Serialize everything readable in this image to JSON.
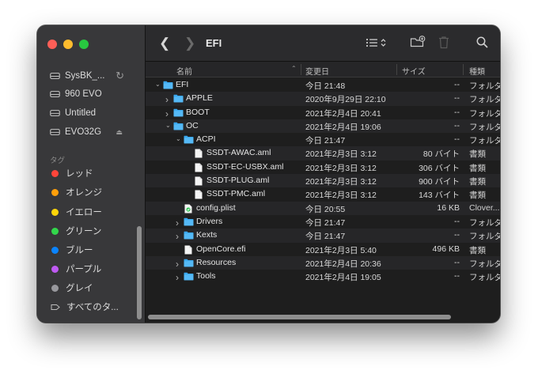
{
  "window": {
    "title": "EFI"
  },
  "sidebar": {
    "devices": [
      {
        "label": "SysBK_...",
        "icon": "disk-icon",
        "badge": "refresh"
      },
      {
        "label": "960 EVO",
        "icon": "disk-icon"
      },
      {
        "label": "Untitled",
        "icon": "disk-icon"
      },
      {
        "label": "EVO32G",
        "icon": "disk-icon",
        "badge": "eject"
      }
    ],
    "tags_heading": "タグ",
    "tags": [
      {
        "label": "レッド",
        "color": "#ff453a"
      },
      {
        "label": "オレンジ",
        "color": "#ff9f0a"
      },
      {
        "label": "イエロー",
        "color": "#ffd60a"
      },
      {
        "label": "グリーン",
        "color": "#32d74b"
      },
      {
        "label": "ブルー",
        "color": "#0a84ff"
      },
      {
        "label": "パープル",
        "color": "#bf5af2"
      },
      {
        "label": "グレイ",
        "color": "#98989d"
      },
      {
        "label": "すべてのタ...",
        "color": ""
      }
    ]
  },
  "columns": {
    "name": "名前",
    "date": "変更日",
    "size": "サイズ",
    "kind": "種類"
  },
  "files": [
    {
      "name": "EFI",
      "date": "今日 21:48",
      "size": "--",
      "kind": "フォルダ",
      "type": "folder",
      "depth": 0,
      "disclosure": "open"
    },
    {
      "name": "APPLE",
      "date": "2020年9月29日 22:10",
      "size": "--",
      "kind": "フォルダ",
      "type": "folder",
      "depth": 1,
      "disclosure": "closed"
    },
    {
      "name": "BOOT",
      "date": "2021年2月4日 20:41",
      "size": "--",
      "kind": "フォルダ",
      "type": "folder",
      "depth": 1,
      "disclosure": "closed"
    },
    {
      "name": "OC",
      "date": "2021年2月4日 19:06",
      "size": "--",
      "kind": "フォルダ",
      "type": "folder",
      "depth": 1,
      "disclosure": "open"
    },
    {
      "name": "ACPI",
      "date": "今日 21:47",
      "size": "--",
      "kind": "フォルダ",
      "type": "folder",
      "depth": 2,
      "disclosure": "open"
    },
    {
      "name": "SSDT-AWAC.aml",
      "date": "2021年2月3日 3:12",
      "size": "80 バイト",
      "kind": "書類",
      "type": "doc",
      "depth": 3,
      "disclosure": ""
    },
    {
      "name": "SSDT-EC-USBX.aml",
      "date": "2021年2月3日 3:12",
      "size": "306 バイト",
      "kind": "書類",
      "type": "doc",
      "depth": 3,
      "disclosure": ""
    },
    {
      "name": "SSDT-PLUG.aml",
      "date": "2021年2月3日 3:12",
      "size": "900 バイト",
      "kind": "書類",
      "type": "doc",
      "depth": 3,
      "disclosure": ""
    },
    {
      "name": "SSDT-PMC.aml",
      "date": "2021年2月3日 3:12",
      "size": "143 バイト",
      "kind": "書類",
      "type": "doc",
      "depth": 3,
      "disclosure": ""
    },
    {
      "name": "config.plist",
      "date": "今日 20:55",
      "size": "16 KB",
      "kind": "Clover...",
      "type": "plist",
      "depth": 2,
      "disclosure": ""
    },
    {
      "name": "Drivers",
      "date": "今日 21:47",
      "size": "--",
      "kind": "フォルダ",
      "type": "folder",
      "depth": 2,
      "disclosure": "closed"
    },
    {
      "name": "Kexts",
      "date": "今日 21:47",
      "size": "--",
      "kind": "フォルダ",
      "type": "folder",
      "depth": 2,
      "disclosure": "closed"
    },
    {
      "name": "OpenCore.efi",
      "date": "2021年2月3日 5:40",
      "size": "496 KB",
      "kind": "書類",
      "type": "doc",
      "depth": 2,
      "disclosure": ""
    },
    {
      "name": "Resources",
      "date": "2021年2月4日 20:36",
      "size": "--",
      "kind": "フォルダ",
      "type": "folder",
      "depth": 2,
      "disclosure": "closed"
    },
    {
      "name": "Tools",
      "date": "2021年2月4日 19:05",
      "size": "--",
      "kind": "フォルダ",
      "type": "folder",
      "depth": 2,
      "disclosure": "closed"
    }
  ]
}
